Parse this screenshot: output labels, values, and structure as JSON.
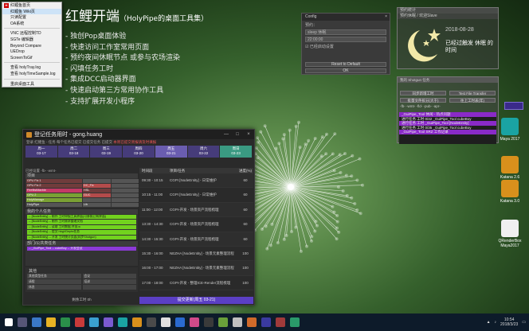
{
  "context_menu": {
    "items": [
      {
        "label": "红鲤鱼首页"
      },
      {
        "label": "红鲤鱼 Wiki页",
        "selected": true
      },
      {
        "label": "只读配置"
      },
      {
        "label": "OA系统"
      },
      {
        "sep": true
      },
      {
        "label": "VNC 远程控制TD"
      },
      {
        "label": "SGTe 编辑器"
      },
      {
        "label": "Beyond Compare"
      },
      {
        "label": "UEDrop"
      },
      {
        "label": "ScreenToGif"
      },
      {
        "sep": true
      },
      {
        "label": "查看 holyTray.log"
      },
      {
        "label": "查看 holyTimeSample.log"
      },
      {
        "sep": true
      },
      {
        "label": "重启桌面工具"
      }
    ]
  },
  "hero": {
    "title": "红鲤开端",
    "subtitle": "（HolyPipe的桌面工具集）",
    "features": [
      "- 独创Pop桌面体验",
      "- 快速访问工作室常用页面",
      "- 预约夜间休眠节点 或参与农场渲染",
      "- 闪填任务工时",
      "- 集成DCC启动器界面",
      "- 快速启动第三方常用协作工具",
      "- 支持扩展开发小程序"
    ]
  },
  "config": {
    "title": "Config",
    "close": "×",
    "label_preset": "预约：",
    "field_mode": "sleep 休眠",
    "field_time": "22:00:00",
    "checkbox": "已经启动设置",
    "reset_button": "Reset to Default",
    "ok_button": "OK"
  },
  "weather": {
    "header": "预约统计",
    "sub": "预约休眠 / 欢迎Slave",
    "date": "2018-08-28",
    "message": "已经过触发 休眠 的时间"
  },
  "shotgun": {
    "header": "我的 Shotgun 任务",
    "btn_sync": "同步新增工时",
    "btn_test": "Test File Transfer",
    "btn_sub1": "批量文件拆分(大于)",
    "btn_sub2": "往上工时表(年)",
    "filter": "-fb- -wmt- -fld- -pub- -apr-",
    "items": [
      {
        "text": "_GuiPipe_Tool 休闲 - 热点问题",
        "style": "pu"
      },
      {
        "text": "进行任务 工时 0/42  _GuiPipe_Tool  cubeBoy",
        "style": "pu"
      },
      {
        "text": "进行任务 工时  _GuiPipe_Tool  [NodeEntity]",
        "style": "pu"
      },
      {
        "text": "进行任务 工时 0/35  _GuiPipe_Tool  cubeBoy",
        "style": "pu"
      },
      {
        "text": "_GuiPipe_Tool  SRZ  工作记录",
        "style": "pu"
      }
    ]
  },
  "desktop_icons": [
    {
      "label": "Maya 2017",
      "color": "#1aa3a3"
    },
    {
      "label": "Katana 2.6",
      "color": "#d8901c"
    },
    {
      "label": "Katana 3.0",
      "color": "#d8901c"
    },
    {
      "label": "QRenderBox Maya2017",
      "color": "#f0f0f0"
    }
  ],
  "app": {
    "title": "登记任务用时 - gong.huang",
    "minimize": "—",
    "maximize": "□",
    "close": "×",
    "status": "登录 红鲤鱼 - 任务 每个任务已提交 已提交任务 已提交",
    "status_warn": "本周已提交周报请及时填报",
    "days": [
      {
        "label": "周一",
        "date": "03-17",
        "style": ""
      },
      {
        "label": "周二",
        "date": "03-18",
        "style": ""
      },
      {
        "label": "周三",
        "date": "03-19",
        "style": ""
      },
      {
        "label": "周四",
        "date": "03-20",
        "style": ""
      },
      {
        "label": "周五",
        "date": "03-21",
        "style": "cur"
      },
      {
        "label": "周六",
        "date": "03-22",
        "style": ""
      },
      {
        "label": "周日",
        "date": "03-23",
        "style": "green"
      }
    ],
    "left_header": "已经设置  -fb- -wmt-",
    "sec_project": "项目",
    "project_rows": [
      [
        "GPU Fix 1",
        "",
        ""
      ],
      [
        "GPU Fix 2",
        "DC_Fix",
        ""
      ],
      [
        "FireflistMarble",
        "HSL",
        ""
      ],
      [
        "GPU 2",
        "GUC",
        ""
      ],
      [
        "HolyManage",
        "",
        ""
      ],
      [
        "HolyPipe",
        "Lib",
        ""
      ]
    ],
    "sec_tasks": "我的个人任务",
    "tasks": [
      {
        "text": "-- [NodeEntity] -- 制作 工时申报工具界面(可参照已有界面)",
        "style": ""
      },
      {
        "text": "-- [NodeEntity] -- 制作 工时需求整理文档",
        "style": ""
      },
      {
        "text": "-- [NodeEntity] -- 读取 工时数据 并显示",
        "style": ""
      },
      {
        "text": "-- [NodeEntity] -- 提交 hbgVDepts任务",
        "style": ""
      },
      {
        "text": "-- [NodeEntity] -- 开发 工时统计页面(同步Shotgun)",
        "style": ""
      }
    ],
    "sec_dept": "部门/公共类任务",
    "dept_tasks": [
      {
        "text": "-- _GuiPipe_Tool -- cubeBoy -- 开发会议",
        "style": "pu"
      }
    ],
    "sec_other": "其他",
    "other_rows": [
      [
        "其他类型任务",
        "会议"
      ],
      [
        "请假",
        "培训"
      ],
      [
        "休息",
        ""
      ]
    ],
    "summary": "剩余工时 0h",
    "table_head": {
      "time": "时间段",
      "task": "项目/任务",
      "pct": "进度(%)"
    },
    "rows": [
      {
        "time": "09:30 - 10:15",
        "task": "CGPI [NodeEntity] - 日常维护",
        "pct": "60"
      },
      {
        "time": "10:15 - 11:00",
        "task": "CGPI [NodeEntity] - 日常维护",
        "pct": "60"
      },
      {
        "time": "11:00 - 12:00",
        "task": "CGPI-开发 - 场景资产流程梳理",
        "pct": "60"
      },
      {
        "time": "13:30 - 14:30",
        "task": "CGPI-开发 - 场景资产流程梳理",
        "pct": "60"
      },
      {
        "time": "14:30 - 15:30",
        "task": "CGPI-开发 - 场景资产流程梳理",
        "pct": "60"
      },
      {
        "time": "15:30 - 16:00",
        "task": "NEZHA [NodeEntity] - 场景元素整理流程",
        "pct": "100"
      },
      {
        "time": "16:00 - 17:00",
        "task": "NEZHA [NodeEntity] - 场景元素整理流程",
        "pct": "100"
      },
      {
        "time": "17:00 - 18:00",
        "task": "CGPI-开发 - 整理ICE-Render流程梳理",
        "pct": "100"
      }
    ],
    "submit": "提交更新(周五 03-21)"
  },
  "taskbar": {
    "time": "10:54",
    "date": "2018/3/23"
  }
}
